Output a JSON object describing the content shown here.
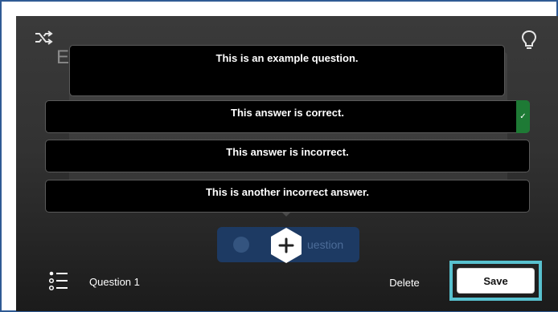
{
  "editor": {
    "question_text": "This is an example question.",
    "answers": [
      {
        "text": "This answer is correct.",
        "correct": true
      },
      {
        "text": "This answer is incorrect.",
        "correct": false
      },
      {
        "text": "This is another incorrect answer.",
        "correct": false
      }
    ],
    "correct_mark": "✓"
  },
  "footer": {
    "question_label": "Question 1",
    "delete_label": "Delete",
    "save_label": "Save"
  },
  "icons": {
    "shuffle": "shuffle-icon",
    "hint": "lightbulb-icon",
    "add": "plus-icon",
    "list": "list-icon",
    "check": "check-icon"
  },
  "colors": {
    "frame_border": "#2f5a94",
    "correct_green": "#1e7a35",
    "save_highlight": "#58c1cf",
    "card_background": "#000000"
  }
}
